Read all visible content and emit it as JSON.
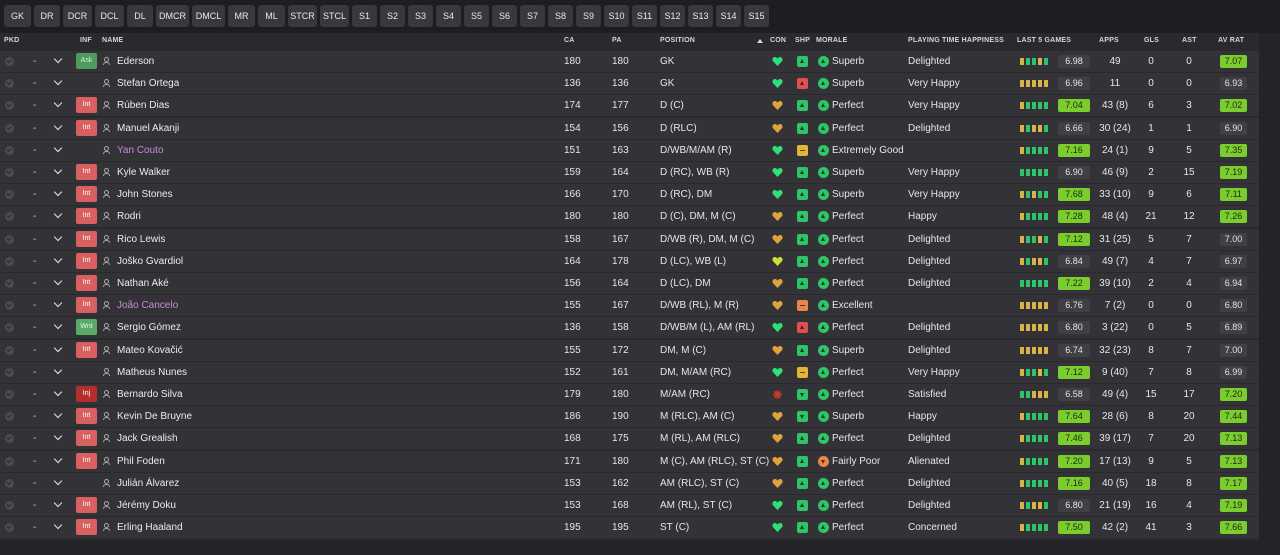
{
  "tabs": [
    "GK",
    "DR",
    "DCR",
    "DCL",
    "DL",
    "DMCR",
    "DMCL",
    "MR",
    "ML",
    "STCR",
    "STCL",
    "S1",
    "S2",
    "S3",
    "S4",
    "S5",
    "S6",
    "S7",
    "S8",
    "S9",
    "S10",
    "S11",
    "S12",
    "S13",
    "S14",
    "S15"
  ],
  "columns": {
    "pkd": "PKD",
    "inf": "INF",
    "name": "NAME",
    "ca": "CA",
    "pa": "PA",
    "position": "POSITION",
    "con": "CON",
    "shp": "SHP",
    "morale": "MORALE",
    "pth": "PLAYING TIME HAPPINESS",
    "form": "LAST 5 GAMES",
    "apps": "APPS",
    "gls": "GLS",
    "ast": "AST",
    "avr": "AV RAT"
  },
  "colors": {
    "accent_green": "#7acc2f",
    "interest_red": "#d96060",
    "form_green": "#2ec46a",
    "form_amber": "#d9b24a",
    "loan_name": "#c78ad6"
  },
  "players": [
    {
      "pkd": "-",
      "inf": "Ask",
      "inf_type": "ask",
      "name": "Ederson",
      "loan": false,
      "ca": "180",
      "pa": "180",
      "position": "GK",
      "con": "green",
      "shp": "green",
      "mor": "green",
      "morale": "Superb",
      "pth": "Delighted",
      "form_levels": [
        "amber",
        "green",
        "green",
        "amber",
        "green"
      ],
      "form_rating": "6.98",
      "form_hl": false,
      "apps": "49",
      "gls": "0",
      "ast": "0",
      "avr": "7.07",
      "avr_hl": true
    },
    {
      "pkd": "-",
      "inf": "",
      "inf_type": "",
      "name": "Stefan Ortega",
      "loan": false,
      "ca": "136",
      "pa": "136",
      "position": "GK",
      "con": "green",
      "shp": "red",
      "mor": "green",
      "morale": "Superb",
      "pth": "Very Happy",
      "form_levels": [
        "dim",
        "dim",
        "dim",
        "dim",
        "dim"
      ],
      "form_rating": "6.96",
      "form_hl": false,
      "apps": "11",
      "gls": "0",
      "ast": "0",
      "avr": "6.93",
      "avr_hl": false
    },
    {
      "pkd": "-",
      "inf": "Int",
      "inf_type": "int",
      "name": "Rúben Dias",
      "loan": false,
      "ca": "174",
      "pa": "177",
      "position": "D (C)",
      "con": "amber",
      "shp": "green",
      "mor": "green",
      "morale": "Perfect",
      "pth": "Very Happy",
      "form_levels": [
        "amber",
        "green",
        "green",
        "green",
        "green"
      ],
      "form_rating": "7.04",
      "form_hl": true,
      "apps": "43 (8)",
      "gls": "6",
      "ast": "3",
      "avr": "7.02",
      "avr_hl": true
    },
    {
      "pkd": "-",
      "inf": "Int",
      "inf_type": "int",
      "name": "Manuel Akanji",
      "loan": false,
      "ca": "154",
      "pa": "156",
      "position": "D (RLC)",
      "con": "amber",
      "shp": "green",
      "mor": "green",
      "morale": "Perfect",
      "pth": "Delighted",
      "form_levels": [
        "amber",
        "green",
        "amber",
        "amber",
        "green"
      ],
      "form_rating": "6.66",
      "form_hl": false,
      "apps": "30 (24)",
      "gls": "1",
      "ast": "1",
      "avr": "6.90",
      "avr_hl": false
    },
    {
      "pkd": "-",
      "inf": "",
      "inf_type": "",
      "name": "Yan Couto",
      "loan": true,
      "ca": "151",
      "pa": "163",
      "position": "D/WB/M/AM (R)",
      "con": "green",
      "shp": "amber",
      "mor": "green",
      "morale": "Extremely Good",
      "pth": "",
      "form_levels": [
        "amber",
        "green",
        "green",
        "green",
        "green"
      ],
      "form_rating": "7.16",
      "form_hl": true,
      "apps": "24 (1)",
      "gls": "9",
      "ast": "5",
      "avr": "7.35",
      "avr_hl": true
    },
    {
      "pkd": "-",
      "inf": "Int",
      "inf_type": "int",
      "name": "Kyle Walker",
      "loan": false,
      "ca": "159",
      "pa": "164",
      "position": "D (RC), WB (R)",
      "con": "green",
      "shp": "green",
      "mor": "green",
      "morale": "Superb",
      "pth": "Very Happy",
      "form_levels": [
        "green",
        "green",
        "green",
        "green",
        "green"
      ],
      "form_rating": "6.90",
      "form_hl": false,
      "apps": "46 (9)",
      "gls": "2",
      "ast": "15",
      "avr": "7.19",
      "avr_hl": true
    },
    {
      "pkd": "-",
      "inf": "Int",
      "inf_type": "int",
      "name": "John Stones",
      "loan": false,
      "ca": "166",
      "pa": "170",
      "position": "D (RC), DM",
      "con": "green",
      "shp": "green",
      "mor": "green",
      "morale": "Superb",
      "pth": "Very Happy",
      "form_levels": [
        "amber",
        "green",
        "amber",
        "green",
        "green"
      ],
      "form_rating": "7.68",
      "form_hl": true,
      "apps": "33 (10)",
      "gls": "9",
      "ast": "6",
      "avr": "7.11",
      "avr_hl": true
    },
    {
      "pkd": "-",
      "inf": "Int",
      "inf_type": "int",
      "name": "Rodri",
      "loan": false,
      "ca": "180",
      "pa": "180",
      "position": "D (C), DM, M (C)",
      "con": "amber",
      "shp": "green",
      "mor": "green",
      "morale": "Perfect",
      "pth": "Happy",
      "form_levels": [
        "amber",
        "green",
        "green",
        "green",
        "green"
      ],
      "form_rating": "7.28",
      "form_hl": true,
      "apps": "48 (4)",
      "gls": "21",
      "ast": "12",
      "avr": "7.26",
      "avr_hl": true
    },
    {
      "pkd": "-",
      "inf": "Int",
      "inf_type": "int",
      "name": "Rico Lewis",
      "loan": false,
      "ca": "158",
      "pa": "167",
      "position": "D/WB (R), DM, M (C)",
      "con": "amber",
      "shp": "green",
      "mor": "green",
      "morale": "Perfect",
      "pth": "Delighted",
      "form_levels": [
        "amber",
        "green",
        "green",
        "amber",
        "green"
      ],
      "form_rating": "7.12",
      "form_hl": true,
      "apps": "31 (25)",
      "gls": "5",
      "ast": "7",
      "avr": "7.00",
      "avr_hl": false
    },
    {
      "pkd": "-",
      "inf": "Int",
      "inf_type": "int",
      "name": "Joško Gvardiol",
      "loan": false,
      "ca": "164",
      "pa": "178",
      "position": "D (LC), WB (L)",
      "con": "yellow",
      "shp": "green",
      "mor": "green",
      "morale": "Perfect",
      "pth": "Delighted",
      "form_levels": [
        "amber",
        "green",
        "amber",
        "amber",
        "green"
      ],
      "form_rating": "6.84",
      "form_hl": false,
      "apps": "49 (7)",
      "gls": "4",
      "ast": "7",
      "avr": "6.97",
      "avr_hl": false
    },
    {
      "pkd": "-",
      "inf": "Int",
      "inf_type": "int",
      "name": "Nathan Aké",
      "loan": false,
      "ca": "156",
      "pa": "164",
      "position": "D (LC), DM",
      "con": "amber",
      "shp": "green",
      "mor": "green",
      "morale": "Perfect",
      "pth": "Delighted",
      "form_levels": [
        "green",
        "green",
        "green",
        "green",
        "green"
      ],
      "form_rating": "7.22",
      "form_hl": true,
      "apps": "39 (10)",
      "gls": "2",
      "ast": "4",
      "avr": "6.94",
      "avr_hl": false
    },
    {
      "pkd": "-",
      "inf": "Int",
      "inf_type": "int",
      "name": "João Cancelo",
      "loan": true,
      "ca": "155",
      "pa": "167",
      "position": "D/WB (RL), M (R)",
      "con": "amber",
      "shp": "orange",
      "mor": "green",
      "morale": "Excellent",
      "pth": "",
      "form_levels": [
        "dim",
        "dim",
        "dim",
        "dim",
        "dim"
      ],
      "form_rating": "6.76",
      "form_hl": false,
      "apps": "7 (2)",
      "gls": "0",
      "ast": "0",
      "avr": "6.80",
      "avr_hl": false
    },
    {
      "pkd": "-",
      "inf": "Wnt",
      "inf_type": "wnt",
      "name": "Sergio Gómez",
      "loan": false,
      "ca": "136",
      "pa": "158",
      "position": "D/WB/M (L), AM (RL)",
      "con": "green",
      "shp": "red",
      "mor": "green",
      "morale": "Perfect",
      "pth": "Delighted",
      "form_levels": [
        "dim",
        "dim",
        "amber",
        "amber",
        "dim"
      ],
      "form_rating": "6.80",
      "form_hl": false,
      "apps": "3 (22)",
      "gls": "0",
      "ast": "5",
      "avr": "6.89",
      "avr_hl": false
    },
    {
      "pkd": "-",
      "inf": "Int",
      "inf_type": "int",
      "name": "Mateo Kovačić",
      "loan": false,
      "ca": "155",
      "pa": "172",
      "position": "DM, M (C)",
      "con": "amber",
      "shp": "green",
      "mor": "green",
      "morale": "Superb",
      "pth": "Delighted",
      "form_levels": [
        "dim",
        "dim",
        "dim",
        "dim",
        "dim"
      ],
      "form_rating": "6.74",
      "form_hl": false,
      "apps": "32 (23)",
      "gls": "8",
      "ast": "7",
      "avr": "7.00",
      "avr_hl": false
    },
    {
      "pkd": "-",
      "inf": "",
      "inf_type": "",
      "name": "Matheus Nunes",
      "loan": false,
      "ca": "152",
      "pa": "161",
      "position": "DM, M/AM (RC)",
      "con": "green",
      "shp": "amber",
      "mor": "green",
      "morale": "Perfect",
      "pth": "Very Happy",
      "form_levels": [
        "amber",
        "green",
        "green",
        "amber",
        "green"
      ],
      "form_rating": "7.12",
      "form_hl": true,
      "apps": "9 (40)",
      "gls": "7",
      "ast": "8",
      "avr": "6.99",
      "avr_hl": false
    },
    {
      "pkd": "-",
      "inf": "Inj",
      "inf_type": "inj",
      "name": "Bernardo Silva",
      "loan": false,
      "ca": "179",
      "pa": "180",
      "position": "M/AM (RC)",
      "con": "injury",
      "shp": "gdown",
      "mor": "green",
      "morale": "Perfect",
      "pth": "Satisfied",
      "form_levels": [
        "green",
        "green",
        "amber",
        "dim",
        "dim"
      ],
      "form_rating": "6.58",
      "form_hl": false,
      "apps": "49 (4)",
      "gls": "15",
      "ast": "17",
      "avr": "7.20",
      "avr_hl": true
    },
    {
      "pkd": "-",
      "inf": "Int",
      "inf_type": "int",
      "name": "Kevin De Bruyne",
      "loan": false,
      "ca": "186",
      "pa": "190",
      "position": "M (RLC), AM (C)",
      "con": "amber",
      "shp": "gdown",
      "mor": "green",
      "morale": "Superb",
      "pth": "Happy",
      "form_levels": [
        "amber",
        "green",
        "green",
        "green",
        "green"
      ],
      "form_rating": "7.64",
      "form_hl": true,
      "apps": "28 (6)",
      "gls": "8",
      "ast": "20",
      "avr": "7.44",
      "avr_hl": true
    },
    {
      "pkd": "-",
      "inf": "Int",
      "inf_type": "int",
      "name": "Jack Grealish",
      "loan": false,
      "ca": "168",
      "pa": "175",
      "position": "M (RL), AM (RLC)",
      "con": "amber",
      "shp": "green",
      "mor": "green",
      "morale": "Perfect",
      "pth": "Delighted",
      "form_levels": [
        "amber",
        "green",
        "green",
        "green",
        "green"
      ],
      "form_rating": "7.46",
      "form_hl": true,
      "apps": "39 (17)",
      "gls": "7",
      "ast": "20",
      "avr": "7.13",
      "avr_hl": true
    },
    {
      "pkd": "-",
      "inf": "Int",
      "inf_type": "int",
      "name": "Phil Foden",
      "loan": false,
      "ca": "171",
      "pa": "180",
      "position": "M (C), AM (RLC), ST (C)",
      "con": "amber",
      "shp": "green",
      "mor": "orange",
      "morale": "Fairly Poor",
      "pth": "Alienated",
      "form_levels": [
        "amber",
        "green",
        "green",
        "green",
        "green"
      ],
      "form_rating": "7.20",
      "form_hl": true,
      "apps": "17 (13)",
      "gls": "9",
      "ast": "5",
      "avr": "7.13",
      "avr_hl": true
    },
    {
      "pkd": "-",
      "inf": "",
      "inf_type": "",
      "name": "Julián Álvarez",
      "loan": false,
      "ca": "153",
      "pa": "162",
      "position": "AM (RLC), ST (C)",
      "con": "amber",
      "shp": "green",
      "mor": "green",
      "morale": "Perfect",
      "pth": "Delighted",
      "form_levels": [
        "amber",
        "green",
        "green",
        "green",
        "green"
      ],
      "form_rating": "7.16",
      "form_hl": true,
      "apps": "40 (5)",
      "gls": "18",
      "ast": "8",
      "avr": "7.17",
      "avr_hl": true
    },
    {
      "pkd": "-",
      "inf": "Int",
      "inf_type": "int",
      "name": "Jérémy Doku",
      "loan": false,
      "ca": "153",
      "pa": "168",
      "position": "AM (RL), ST (C)",
      "con": "green",
      "shp": "green",
      "mor": "green",
      "morale": "Perfect",
      "pth": "Delighted",
      "form_levels": [
        "amber",
        "green",
        "amber",
        "amber",
        "green"
      ],
      "form_rating": "6.80",
      "form_hl": false,
      "apps": "21 (19)",
      "gls": "16",
      "ast": "4",
      "avr": "7.19",
      "avr_hl": true
    },
    {
      "pkd": "-",
      "inf": "Int",
      "inf_type": "int",
      "name": "Erling Haaland",
      "loan": false,
      "ca": "195",
      "pa": "195",
      "position": "ST (C)",
      "con": "green",
      "shp": "green",
      "mor": "green",
      "morale": "Perfect",
      "pth": "Concerned",
      "form_levels": [
        "amber",
        "green",
        "green",
        "green",
        "green"
      ],
      "form_rating": "7.50",
      "form_hl": true,
      "apps": "42 (2)",
      "gls": "41",
      "ast": "3",
      "avr": "7.66",
      "avr_hl": true
    }
  ]
}
